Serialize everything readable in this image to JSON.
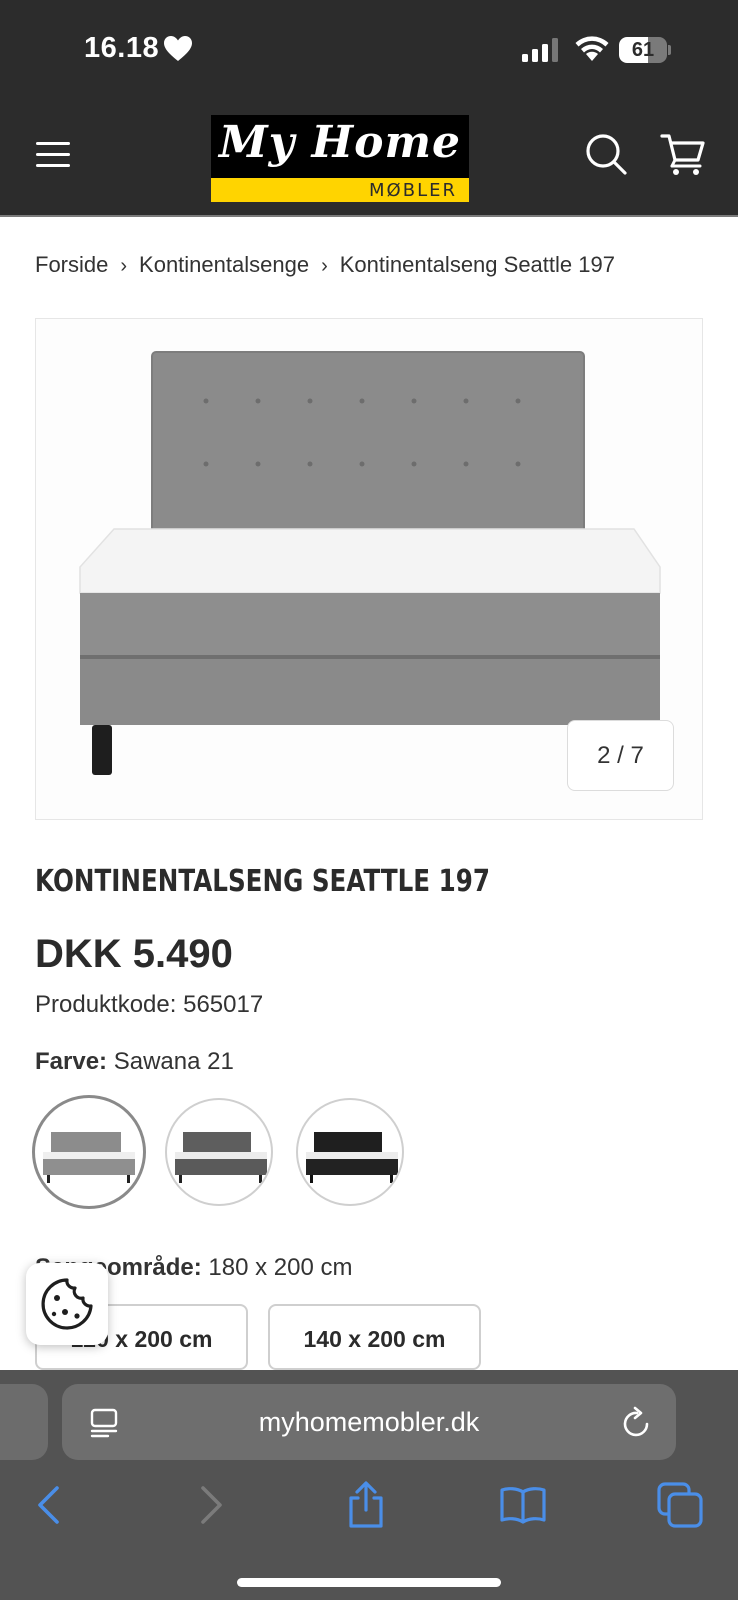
{
  "status_bar": {
    "time": "16.18",
    "battery": "61",
    "battery_level": 0.61
  },
  "header": {
    "logo_title": "My Home",
    "logo_subtitle": "MØBLER",
    "icons": [
      "menu-icon",
      "search-icon",
      "cart-icon"
    ]
  },
  "breadcrumb": {
    "items": [
      "Forside",
      "Kontinentalsenge",
      "Kontinentalseng Seattle 197"
    ],
    "separator": "›"
  },
  "gallery": {
    "counter": "2 / 7"
  },
  "product": {
    "title": "KONTINENTALSENG SEATTLE 197",
    "price": "DKK 5.490",
    "code_label": "Produktkode:",
    "code_value": "565017",
    "color_label": "Farve:",
    "color_value": "Sawana 21",
    "swatches": [
      "light-grey",
      "dark-grey",
      "black"
    ],
    "selected_swatch": 0,
    "size_label": "Sengeområde:",
    "size_value": "180 x 200 cm",
    "size_options": [
      "120 x 200 cm",
      "140 x 200 cm"
    ]
  },
  "browser": {
    "url": "myhomemobler.dk"
  },
  "colors": {
    "header_bg": "#2c2c2c",
    "logo_yellow": "#ffd400",
    "safari_bar": "#535353",
    "safari_accent": "#4a8ee8"
  }
}
